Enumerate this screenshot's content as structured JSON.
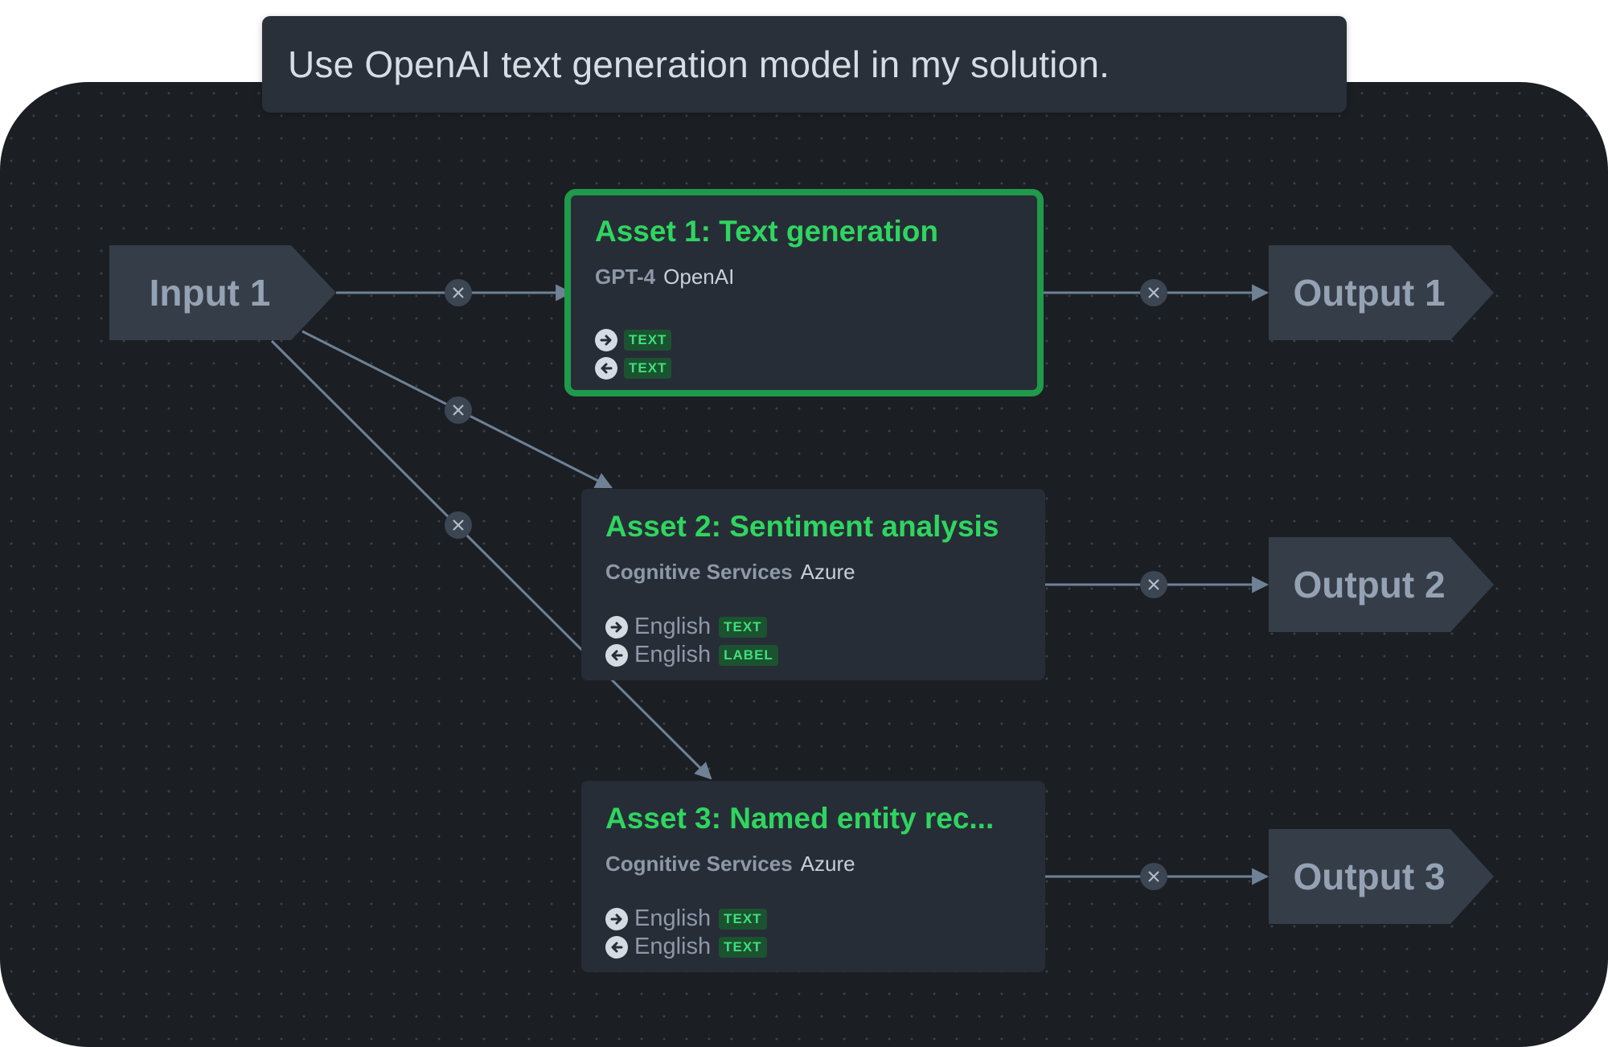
{
  "prompt": {
    "text": "Use OpenAI text generation model in my solution."
  },
  "input": {
    "label": "Input 1"
  },
  "outputs": [
    {
      "label": "Output 1"
    },
    {
      "label": "Output 2"
    },
    {
      "label": "Output 3"
    }
  ],
  "assets": [
    {
      "title": "Asset 1: Text generation",
      "model": "GPT-4",
      "vendor": "OpenAI",
      "selected": true,
      "io": [
        {
          "direction": "in",
          "icon": "arrow-right-circle-icon",
          "lang": "",
          "type": "TEXT"
        },
        {
          "direction": "out",
          "icon": "arrow-left-circle-icon",
          "lang": "",
          "type": "TEXT"
        }
      ]
    },
    {
      "title": "Asset 2: Sentiment analysis",
      "model": "Cognitive Services",
      "vendor": "Azure",
      "selected": false,
      "io": [
        {
          "direction": "in",
          "icon": "arrow-right-circle-icon",
          "lang": "English",
          "type": "TEXT"
        },
        {
          "direction": "out",
          "icon": "arrow-left-circle-icon",
          "lang": "English",
          "type": "LABEL"
        }
      ]
    },
    {
      "title": "Asset 3: Named entity rec...",
      "model": "Cognitive Services",
      "vendor": "Azure",
      "selected": false,
      "io": [
        {
          "direction": "in",
          "icon": "arrow-right-circle-icon",
          "lang": "English",
          "type": "TEXT"
        },
        {
          "direction": "out",
          "icon": "arrow-left-circle-icon",
          "lang": "English",
          "type": "TEXT"
        }
      ]
    }
  ],
  "colors": {
    "canvas": "#1b1f24",
    "node": "#272d36",
    "accent_green": "#2fd560",
    "selected_border": "#1f9a4a",
    "edge": "#6f8195",
    "port": "#353d48"
  },
  "icons": {
    "edge_delete": "close-icon"
  }
}
